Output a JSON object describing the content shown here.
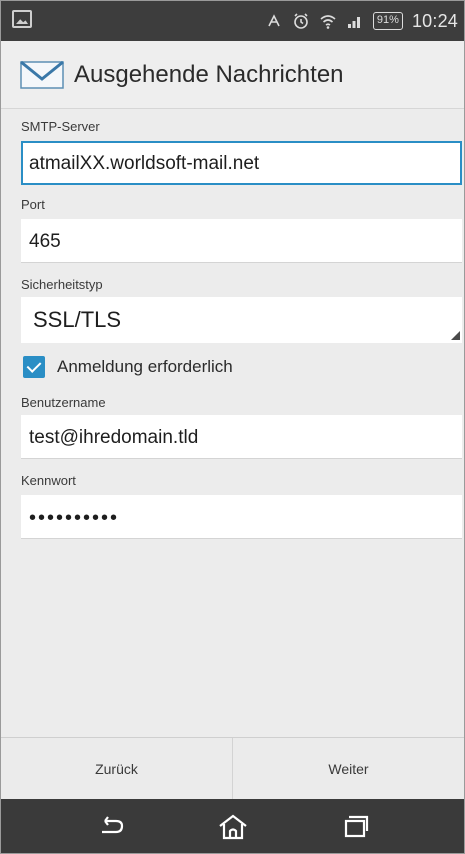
{
  "status_bar": {
    "battery_text": "91%",
    "time": "10:24",
    "icons": [
      "image-icon",
      "nfc-icon",
      "alarm-icon",
      "wifi-icon",
      "signal-icon",
      "battery-icon"
    ]
  },
  "title_bar": {
    "icon": "mail-envelope-icon",
    "title": "Ausgehende Nachrichten"
  },
  "form": {
    "smtp_label": "SMTP-Server",
    "smtp_value": "atmailXX.worldsoft-mail.net",
    "port_label": "Port",
    "port_value": "465",
    "security_label": "Sicherheitstyp",
    "security_value": "SSL/TLS",
    "login_required_label": "Anmeldung erforderlich",
    "login_required_checked": true,
    "username_label": "Benutzername",
    "username_value": "test@ihredomain.tld",
    "password_label": "Kennwort",
    "password_value": "••••••••••"
  },
  "buttons": {
    "back": "Zurück",
    "next": "Weiter"
  },
  "nav_bar": {
    "icons": [
      "back-icon",
      "home-icon",
      "recent-apps-icon"
    ]
  },
  "colors": {
    "accent": "#2a8ec5",
    "status_bar": "#3d3d3d",
    "nav_bar": "#3a3a3a",
    "background": "#ececec"
  }
}
